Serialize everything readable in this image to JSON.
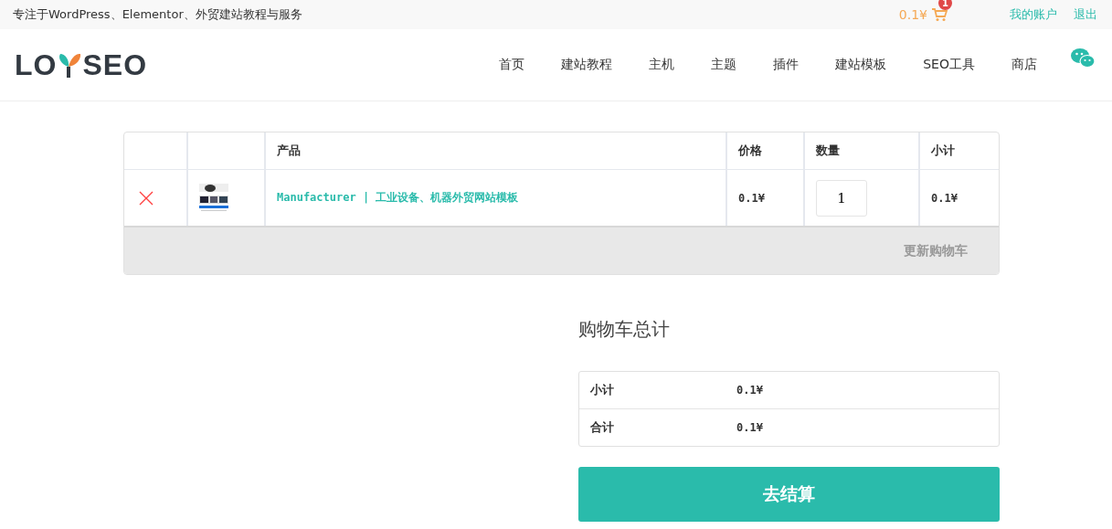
{
  "top_bar": {
    "tagline": "专注于WordPress、Elementor、外贸建站教程与服务",
    "cart_total": "0.1¥",
    "cart_count": "1",
    "links": [
      "我的账户",
      "退出"
    ]
  },
  "header": {
    "logo": {
      "left": "LO",
      "right": "SEO"
    },
    "nav": [
      {
        "label": "首页",
        "selected": false
      },
      {
        "label": "建站教程",
        "selected": false
      },
      {
        "label": "主机",
        "selected": false
      },
      {
        "label": "主题",
        "selected": false
      },
      {
        "label": "插件",
        "selected": false
      },
      {
        "label": "建站模板",
        "selected": false
      },
      {
        "label": "SEO工具",
        "selected": false
      },
      {
        "label": "商店",
        "selected": false
      }
    ]
  },
  "cart": {
    "columns": [
      "产品",
      "价格",
      "数量",
      "小计"
    ],
    "rows": [
      {
        "product": "Manufacturer | 工业设备、机器外贸网站模板",
        "price": "0.1¥",
        "quantity": "1",
        "subtotal": "0.1¥"
      }
    ],
    "update_button": {
      "label": "更新购物车",
      "disabled": true
    }
  },
  "totals": {
    "title": "购物车总计",
    "rows": [
      {
        "label": "小计",
        "value": "0.1¥"
      },
      {
        "label": "合计",
        "value": "0.1¥"
      }
    ],
    "checkout": "去结算"
  }
}
